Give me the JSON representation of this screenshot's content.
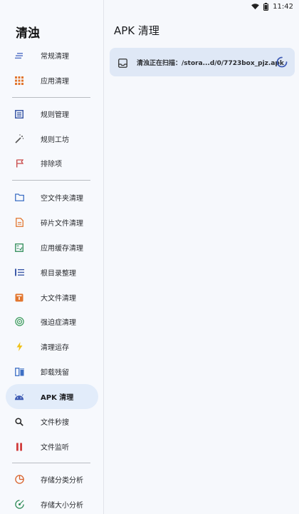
{
  "status_bar": {
    "time": "11:42"
  },
  "app_title": "清浊",
  "page_title": "APK 清理",
  "scan_status": "清浊正在扫描：/stora...d/0/7723box_pjz.apk",
  "nav": {
    "regular_clean": "常规清理",
    "app_clean": "应用清理",
    "rule_manage": "规则管理",
    "rule_workshop": "规则工坊",
    "exclusions": "排除项",
    "empty_folder_clean": "空文件夹清理",
    "fragment_file_clean": "碎片文件清理",
    "app_cache_clean": "应用缓存清理",
    "root_dir_organize": "根目录整理",
    "large_file_clean": "大文件清理",
    "ocd_clean": "强迫症清理",
    "memory_clean": "清理运存",
    "uninstall_residue": "卸载残留",
    "apk_clean": "APK 清理",
    "file_quick_search": "文件秒搜",
    "file_monitor": "文件监听",
    "storage_category_analysis": "存储分类分析",
    "storage_size_analysis": "存储大小分析"
  },
  "colors": {
    "accent_active_bg": "#e2ecfa",
    "card_bg": "#dfe8f6",
    "android_green": "#3ddc84",
    "apk_icon_blue": "#3e5bb4"
  }
}
